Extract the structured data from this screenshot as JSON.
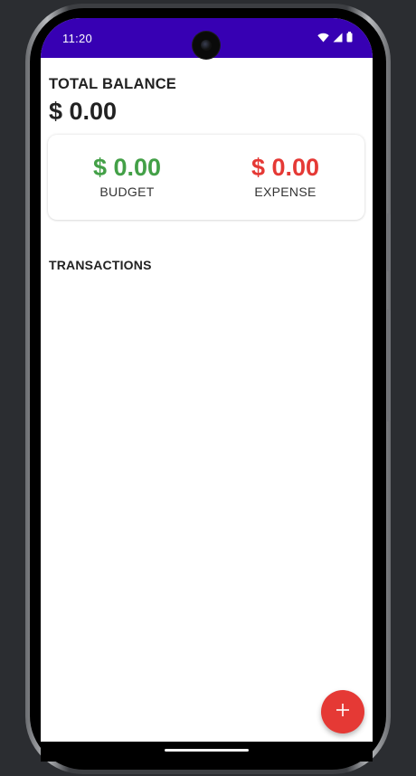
{
  "status_bar": {
    "time": "11:20",
    "icons": [
      "wifi-icon",
      "cellular-signal-icon",
      "battery-icon"
    ],
    "background_color": "#3700b3"
  },
  "balance": {
    "label": "TOTAL BALANCE",
    "value": "$ 0.00"
  },
  "summary": {
    "budget": {
      "amount": "$ 0.00",
      "label": "BUDGET",
      "color": "#43a047"
    },
    "expense": {
      "amount": "$ 0.00",
      "label": "EXPENSE",
      "color": "#e53935"
    }
  },
  "transactions": {
    "title": "TRANSACTIONS",
    "items": []
  },
  "fab": {
    "icon": "plus-icon",
    "color": "#e53935"
  }
}
